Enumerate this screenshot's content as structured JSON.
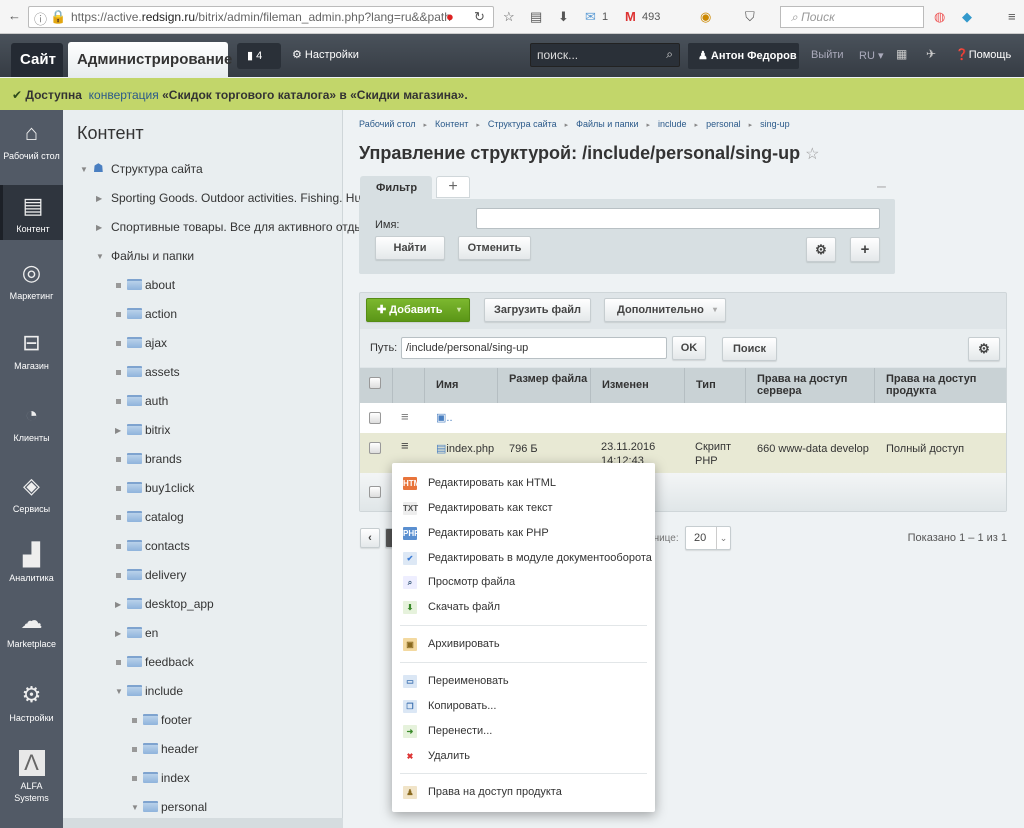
{
  "browser": {
    "url_prefix": "https://active.",
    "url_domain": "redsign.ru",
    "url_rest": "/bitrix/admin/fileman_admin.php?lang=ru&&path",
    "mail_count": "1",
    "gmail_count": "493",
    "search_placeholder": "Поиск"
  },
  "topbar": {
    "site": "Сайт",
    "admin": "Администрирование",
    "notifications": "4",
    "settings": "Настройки",
    "search_placeholder": "поиск...",
    "user": "Антон Федоров",
    "logout": "Выйти",
    "lang": "RU",
    "help": "Помощь"
  },
  "alert": {
    "prefix": "Доступна",
    "link": "конвертация",
    "text": "«Скидок торгового каталога» в «Скидки магазина»."
  },
  "sidebar": {
    "items": [
      {
        "label": "Рабочий стол",
        "icon": "home-icon"
      },
      {
        "label": "Контент",
        "icon": "document-icon",
        "active": true
      },
      {
        "label": "Маркетинг",
        "icon": "target-icon"
      },
      {
        "label": "Магазин",
        "icon": "basket-icon"
      },
      {
        "label": "Клиенты",
        "icon": "clock-24-icon"
      },
      {
        "label": "Сервисы",
        "icon": "layers-icon"
      },
      {
        "label": "Аналитика",
        "icon": "bar-chart-icon"
      },
      {
        "label": "Marketplace",
        "icon": "cloud-download-icon"
      },
      {
        "label": "Настройки",
        "icon": "gear-icon"
      },
      {
        "label": "ALFA Systems",
        "icon": "alfa-logo-icon"
      }
    ]
  },
  "tree": {
    "title": "Контент",
    "root": "Структура сайта",
    "sites": [
      "Sporting Goods. Outdoor activities. Fishing. Hunti",
      "Спортивные товары. Все для активного отдыха."
    ],
    "files_label": "Файлы и папки",
    "folders": [
      {
        "name": "about"
      },
      {
        "name": "action"
      },
      {
        "name": "ajax"
      },
      {
        "name": "assets"
      },
      {
        "name": "auth"
      },
      {
        "name": "bitrix",
        "expandable": true
      },
      {
        "name": "brands"
      },
      {
        "name": "buy1click"
      },
      {
        "name": "catalog"
      },
      {
        "name": "contacts"
      },
      {
        "name": "delivery"
      },
      {
        "name": "desktop_app",
        "expandable": true
      },
      {
        "name": "en",
        "expandable": true
      },
      {
        "name": "feedback"
      },
      {
        "name": "include",
        "expanded": true
      }
    ],
    "include_children": [
      {
        "name": "footer"
      },
      {
        "name": "header"
      },
      {
        "name": "index"
      },
      {
        "name": "personal",
        "expanded": true
      }
    ]
  },
  "main": {
    "breadcrumbs": [
      "Рабочий стол",
      "Контент",
      "Структура сайта",
      "Файлы и папки",
      "include",
      "personal",
      "sing-up"
    ],
    "title": "Управление структурой: /include/personal/sing-up",
    "filter": {
      "tab": "Фильтр",
      "name_label": "Имя:",
      "name_value": "",
      "find": "Найти",
      "cancel": "Отменить"
    },
    "toolbar": {
      "add": "Добавить",
      "upload": "Загрузить файл",
      "more": "Дополнительно",
      "path_label": "Путь:",
      "path_value": "/include/personal/sing-up",
      "ok": "OK",
      "search": "Поиск"
    },
    "table": {
      "headers": [
        "Имя",
        "Размер файла",
        "Изменен",
        "Тип",
        "Права на доступ сервера",
        "Права на доступ продукта"
      ],
      "up_row": "..",
      "rows": [
        {
          "name": "index.php",
          "size": "796 Б",
          "modified": "23.11.2016 14:12:43",
          "type": "Скрипт PHP",
          "server_rights": "660 www-data develop",
          "product_rights": "Полный доступ"
        }
      ]
    },
    "pagination": {
      "per_page_label": "на странице:",
      "per_page": "20",
      "shown": "Показано 1 – 1 из 1"
    }
  },
  "context_menu": {
    "items": [
      {
        "label": "Редактировать как HTML",
        "icon": "html-icon"
      },
      {
        "label": "Редактировать как текст",
        "icon": "txt-icon"
      },
      {
        "label": "Редактировать как PHP",
        "icon": "php-icon"
      },
      {
        "label": "Редактировать в модуле документооборота",
        "icon": "workflow-icon"
      },
      {
        "label": "Просмотр файла",
        "icon": "view-icon"
      },
      {
        "label": "Скачать файл",
        "icon": "download-icon"
      },
      {
        "label": "Архивировать",
        "icon": "archive-icon"
      },
      {
        "label": "Переименовать",
        "icon": "rename-icon"
      },
      {
        "label": "Копировать...",
        "icon": "copy-icon"
      },
      {
        "label": "Перенести...",
        "icon": "move-icon"
      },
      {
        "label": "Удалить",
        "icon": "delete-icon"
      },
      {
        "label": "Права на доступ продукта",
        "icon": "access-icon"
      }
    ]
  },
  "colors": {
    "accent_green": "#6aa51e",
    "alert_bg": "#c2d66a",
    "sidebar_bg": "#525a66",
    "selected_row": "#e8e9d4"
  }
}
